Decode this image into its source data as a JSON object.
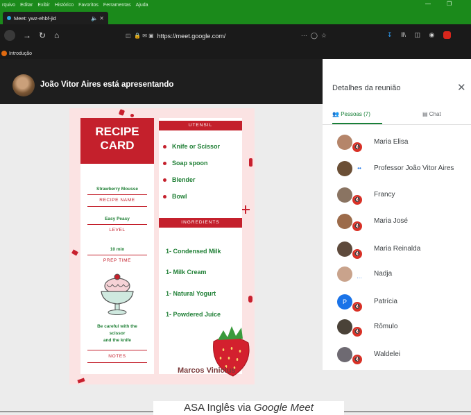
{
  "menubar": {
    "items": [
      "rquivo",
      "Editar",
      "Exibir",
      "Histórico",
      "Favoritos",
      "Ferramentas",
      "Ajuda"
    ]
  },
  "tab": {
    "title": "Meet: ywz-ehbf-jid"
  },
  "urlbar": {
    "url": "https://meet.google.com/"
  },
  "bookmarks": {
    "item": "Introdução"
  },
  "presenter": {
    "text": "João Vitor Aires está apresentando"
  },
  "recipe": {
    "title_line1": "RECIPE",
    "title_line2": "CARD",
    "fields": [
      {
        "value": "Strawberry Mousse",
        "label": "RECIPE NAME"
      },
      {
        "value": "Easy Peasy",
        "label": "LEVEL"
      },
      {
        "value": "10 min",
        "label": "PREP TIME"
      }
    ],
    "notes_value_lines": [
      "Be careful with the",
      "scissor",
      "and the knife"
    ],
    "notes_label": "NOTES",
    "utensil_header": "UTENSIL",
    "utensils": [
      "Knife or Scissor",
      "Soap spoon",
      "Blender",
      "Bowl"
    ],
    "ingredients_header": "INGREDIENTS",
    "ingredients": [
      "1- Condensed Milk",
      "1- Milk Cream",
      "1- Natural Yogurt",
      "1- Powdered Juice"
    ],
    "author": "Marcos Vinicius"
  },
  "panel": {
    "title": "Detalhes da reunião",
    "people_tab": "Pessoas (7)",
    "chat_tab": "Chat",
    "participants": [
      {
        "name": "Maria Elisa",
        "avatar_color": "#b5856a",
        "muted": true
      },
      {
        "name": "Professor João Vitor Aires",
        "avatar_color": "#6b4f36",
        "muted": false
      },
      {
        "name": "Francy",
        "avatar_color": "#8a7462",
        "muted": true
      },
      {
        "name": "Maria José",
        "avatar_color": "#9c6b4a",
        "muted": true
      },
      {
        "name": "Maria Reinalda",
        "avatar_color": "#5e4a3c",
        "muted": true
      },
      {
        "name": "Nadja",
        "avatar_color": "#c9a38c",
        "muted": false
      },
      {
        "name": "Patrícia",
        "avatar_color": "#1a73e8",
        "muted": true,
        "initial": "P"
      },
      {
        "name": "Rômulo",
        "avatar_color": "#4a4238",
        "muted": true
      },
      {
        "name": "Waldelei",
        "avatar_color": "#6e6a72",
        "muted": true
      }
    ]
  },
  "caption": {
    "prefix": "ASA Inglês via ",
    "emphasis": "Google Meet"
  },
  "colors": {
    "browser_green": "#1b8a1b",
    "meet_green": "#188038",
    "recipe_red": "#c4202c",
    "recipe_green": "#1f7f35",
    "mic_off_red": "#d93025"
  }
}
